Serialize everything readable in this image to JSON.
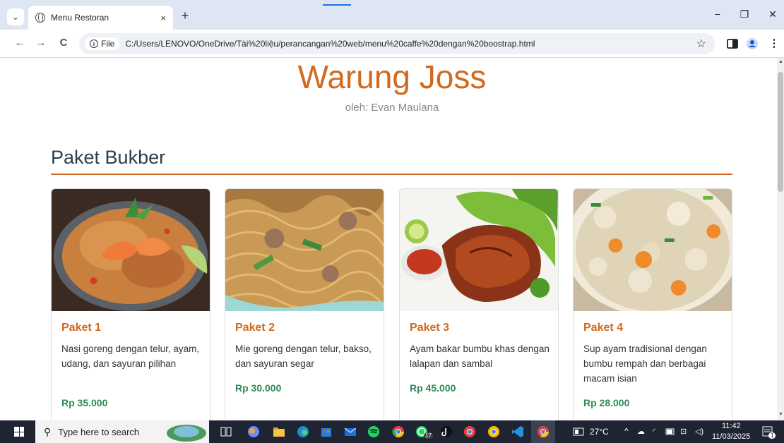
{
  "browser": {
    "tab_title": "Menu Restoran",
    "tab_close": "×",
    "new_tab": "+",
    "info_label": "File",
    "url": "C:/Users/LENOVO/OneDrive/Tài%20liệu/perancangan%20web/menu%20caffe%20dengan%20boostrap.html",
    "win_minimize": "−",
    "win_restore": "❐",
    "win_close": "✕",
    "back": "←",
    "forward": "→",
    "reload": "C",
    "star": "☆",
    "more": "⋮"
  },
  "page": {
    "site_title": "Warung Joss",
    "site_subtitle": "oleh: Evan Maulana",
    "section_title": "Paket Bukber"
  },
  "cards": [
    {
      "name": "Paket 1",
      "desc": "Nasi goreng dengan telur, ayam, udang, dan sayuran pilihan",
      "price": "Rp 35.000",
      "image": "fried-rice-shrimp-photo"
    },
    {
      "name": "Paket 2",
      "desc": "Mie goreng dengan telur, bakso, dan sayuran segar",
      "price": "Rp 30.000",
      "image": "fried-noodles-photo"
    },
    {
      "name": "Paket 3",
      "desc": "Ayam bakar bumbu khas dengan lalapan dan sambal",
      "price": "Rp 45.000",
      "image": "grilled-chicken-photo"
    },
    {
      "name": "Paket 4",
      "desc": "Sup ayam tradisional dengan bumbu rempah dan berbagai macam isian",
      "price": "Rp 28.000",
      "image": "chicken-soup-photo"
    }
  ],
  "taskbar": {
    "search_placeholder": "Type here to search",
    "weather": "27°C",
    "time": "11:42",
    "date": "11/03/2025",
    "notification_count": "1",
    "badge_whatsapp": "17"
  },
  "colors": {
    "accent": "#d2691e",
    "heading": "#2c3e50",
    "price": "#2e8b57",
    "taskbar": "#1f2433"
  }
}
